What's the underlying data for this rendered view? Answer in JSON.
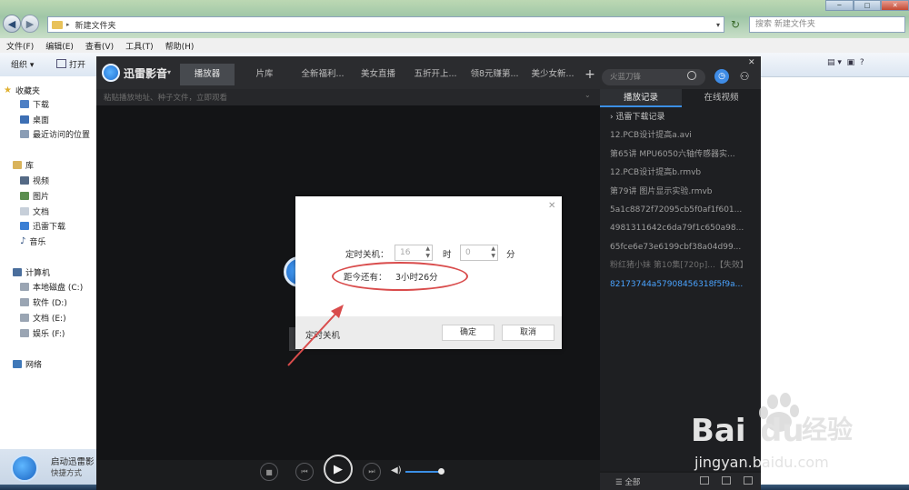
{
  "explorer": {
    "breadcrumb": "新建文件夹",
    "search_placeholder": "搜索 新建文件夹",
    "menu": [
      "文件(F)",
      "编辑(E)",
      "查看(V)",
      "工具(T)",
      "帮助(H)"
    ],
    "toolbar": {
      "organize": "组织 ▾",
      "open": "打开"
    },
    "sidebar": {
      "favorites": "收藏夹",
      "fav_items": [
        "下载",
        "桌面",
        "最近访问的位置"
      ],
      "libraries": "库",
      "lib_items": [
        "视频",
        "图片",
        "文档",
        "迅雷下载",
        "音乐"
      ],
      "computer": "计算机",
      "drives": [
        "本地磁盘 (C:)",
        "软件 (D:)",
        "文档 (E:)",
        "娱乐 (F:)"
      ],
      "network": "网络"
    },
    "status": {
      "title": "启动迅雷影",
      "subtitle": "快捷方式"
    }
  },
  "player": {
    "app_name": "迅雷影音",
    "tabs": [
      "播放器",
      "片库",
      "全新福利...",
      "美女直播",
      "五折开上...",
      "领8元赚第...",
      "美少女新..."
    ],
    "search_placeholder": "火蓝刀锋",
    "url_placeholder": "粘贴播放地址、种子文件，立即观看",
    "panel_tabs": {
      "history": "播放记录",
      "online": "在线视频"
    },
    "history_header": "迅雷下载记录",
    "history": [
      "12.PCB设计提高a.avi",
      "第65讲 MPU6050六轴传感器实...",
      "12.PCB设计提高b.rmvb",
      "第79讲 图片显示实验.rmvb",
      "5a1c8872f72095cb5f0af1f601...",
      "4981311642c6da79f1c650a98...",
      "65fce6e73e6199cbf38a04d99...",
      "粉红猪小妹 第10集[720p]...",
      "82173744a57908456318f5f9a..."
    ],
    "history_expired_tag": "【失效】",
    "history_highlight_color": "#4aa3ff",
    "footer_all": "全部"
  },
  "dialog": {
    "label_shutdown": "定时关机：",
    "hour_value": "16",
    "hour_unit": "时",
    "minute_value": "0",
    "minute_unit": "分",
    "remain_label": "距今还有：",
    "remain_value": "3小时26分",
    "footer_label": "定时关机",
    "ok": "确定",
    "cancel": "取消",
    "annotation_color": "#d94c4c"
  },
  "watermark": {
    "brand": "Bai",
    "brand_du": "du",
    "cn": "经验",
    "url": "jingyan.baidu.com"
  }
}
